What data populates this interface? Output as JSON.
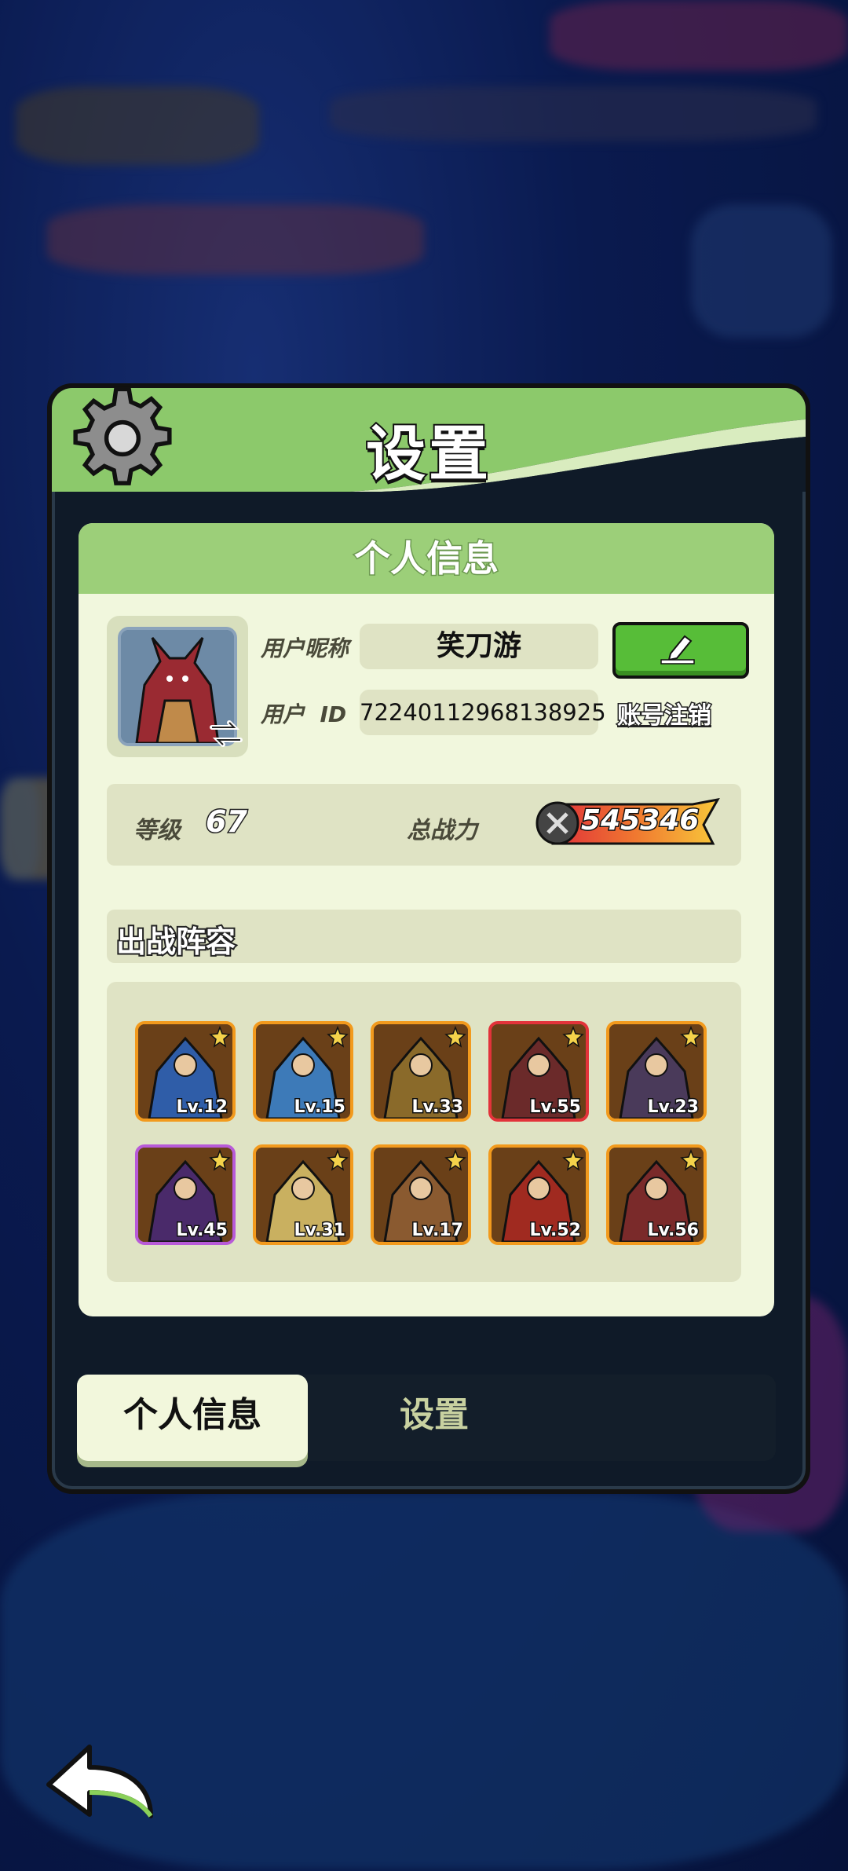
{
  "modal": {
    "title": "设置",
    "panel_title": "个人信息"
  },
  "profile": {
    "nickname_label": "用户昵称",
    "nickname": "笑刀游",
    "id_label": "用户  ID",
    "user_id": "72240112968138925",
    "delete_account_label": "账号注销"
  },
  "stats": {
    "level_label": "等级",
    "level": "67",
    "power_label": "总战力",
    "power": "545346"
  },
  "lineup": {
    "title": "出战阵容",
    "heroes": [
      {
        "lv": "Lv.12",
        "frame": "orange",
        "color": "#2f5da8"
      },
      {
        "lv": "Lv.15",
        "frame": "orange",
        "color": "#3d7ab8"
      },
      {
        "lv": "Lv.33",
        "frame": "orange",
        "color": "#8a6a2a"
      },
      {
        "lv": "Lv.55",
        "frame": "red",
        "color": "#6b2a2a"
      },
      {
        "lv": "Lv.23",
        "frame": "orange",
        "color": "#4a3a5a"
      },
      {
        "lv": "Lv.45",
        "frame": "purple",
        "color": "#4a2a6a"
      },
      {
        "lv": "Lv.31",
        "frame": "orange",
        "color": "#c9b060"
      },
      {
        "lv": "Lv.17",
        "frame": "orange",
        "color": "#8a5a30"
      },
      {
        "lv": "Lv.52",
        "frame": "orange",
        "color": "#a02a20"
      },
      {
        "lv": "Lv.56",
        "frame": "orange",
        "color": "#7a2a2a"
      }
    ]
  },
  "tabs": [
    {
      "label": "个人信息",
      "active": true
    },
    {
      "label": "设置",
      "active": false
    }
  ],
  "colors": {
    "header_green": "#8cc96b",
    "panel_bg": "#f1f7dd",
    "edit_green": "#57bd38"
  }
}
